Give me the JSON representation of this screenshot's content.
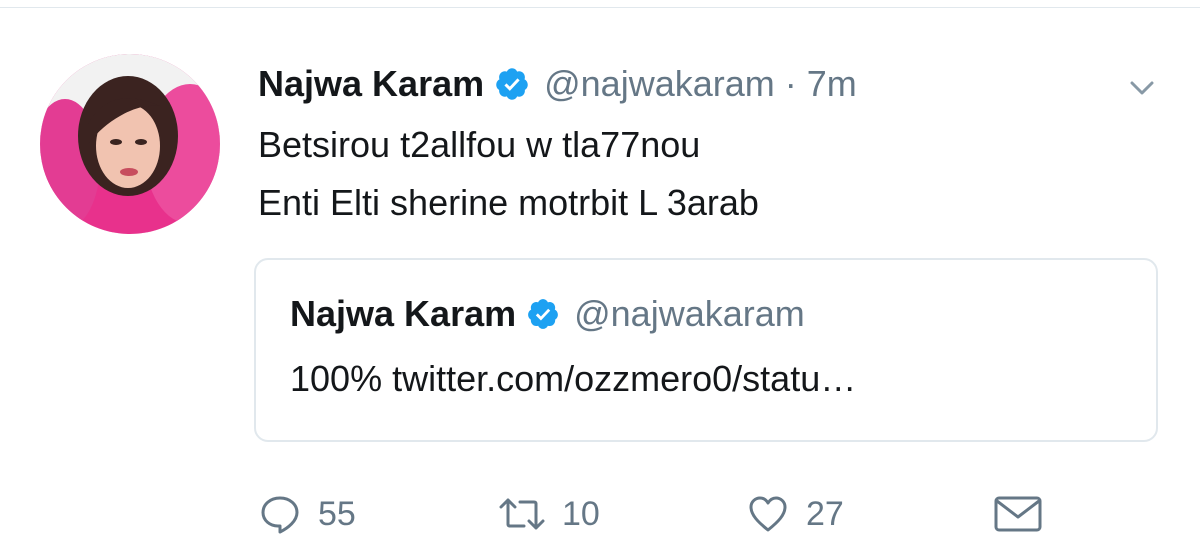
{
  "tweet": {
    "author": {
      "name": "Najwa Karam",
      "handle": "@najwakaram",
      "verified": true
    },
    "separator": "·",
    "time": "7m",
    "text_lines": [
      "Betsirou t2allfou w tla77nou",
      "Enti Elti sherine motrbit L 3arab"
    ],
    "quoted": {
      "name": "Najwa Karam",
      "handle": "@najwakaram",
      "verified": true,
      "text": "100% twitter.com/ozzmero0/statu…"
    },
    "actions": {
      "reply_count": "55",
      "retweet_count": "10",
      "like_count": "27"
    }
  },
  "icons": {
    "verified": "verified-badge-icon",
    "caret": "chevron-down-icon",
    "reply": "reply-bubble-icon",
    "retweet": "retweet-icon",
    "like": "heart-icon",
    "dm": "envelope-icon"
  },
  "colors": {
    "verified_blue": "#1da1f2",
    "text_primary": "#14171a",
    "text_secondary": "#657786",
    "border": "#e1e8ed"
  }
}
